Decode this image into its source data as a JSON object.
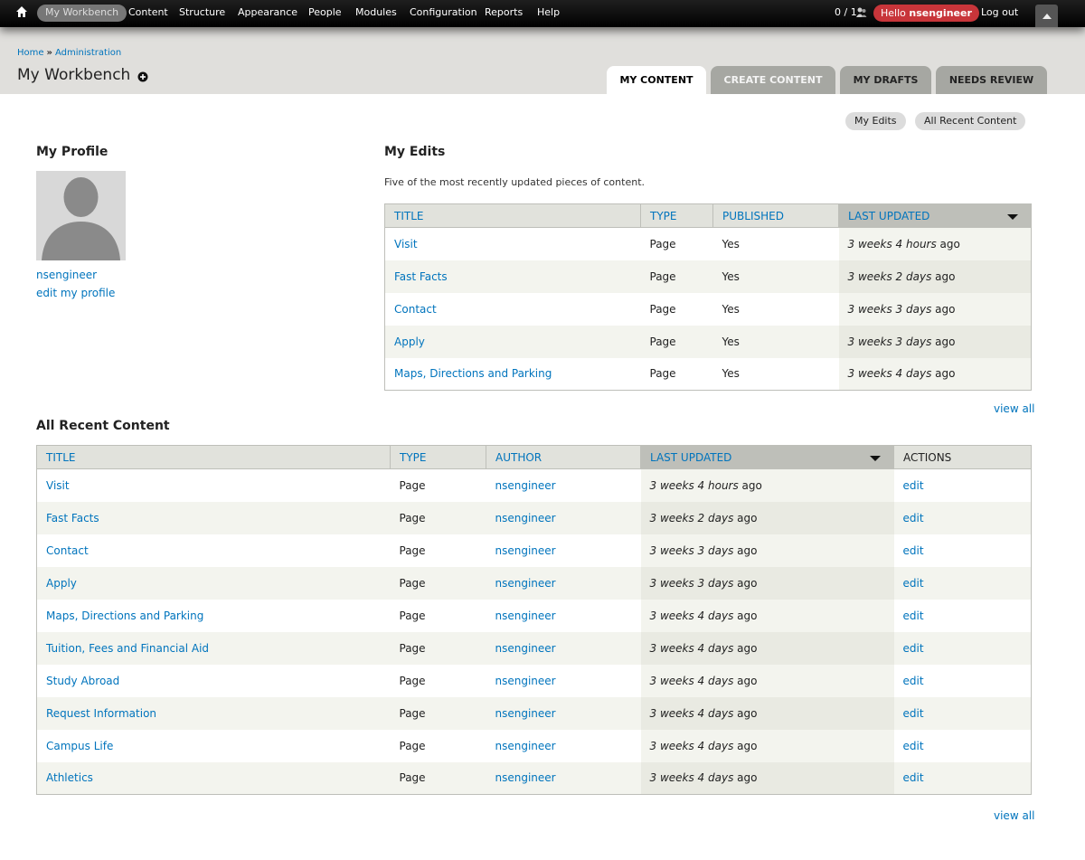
{
  "toolbar": {
    "home_icon": "home-icon",
    "items": [
      "My Workbench",
      "Content",
      "Structure",
      "Appearance",
      "People",
      "Modules",
      "Configuration",
      "Reports",
      "Help"
    ],
    "counter": "0 / 1",
    "people_icon": "people-icon",
    "hello_prefix": "Hello",
    "username": "nsengineer",
    "logout": "Log out",
    "drawer_icon": "triangle-up-icon"
  },
  "header": {
    "breadcrumb": [
      "Home",
      "Administration"
    ],
    "breadcrumb_sep": "»",
    "title": "My Workbench",
    "shortcut_icon": "plus-circle-icon",
    "tabs": [
      "My Content",
      "Create Content",
      "My Drafts",
      "Needs Review"
    ]
  },
  "subtabs": [
    "My Edits",
    "All Recent Content"
  ],
  "profile": {
    "heading": "My Profile",
    "avatar_icon": "user-silhouette-icon",
    "name": "nsengineer",
    "edit_link": "edit my profile"
  },
  "my_edits": {
    "heading": "My Edits",
    "description": "Five of the most recently updated pieces of content.",
    "columns": [
      "Title",
      "Type",
      "Published",
      "Last updated"
    ],
    "rows": [
      {
        "title": "Visit",
        "type": "Page",
        "published": "Yes",
        "updated_em": "3 weeks 4 hours",
        "updated_tail": " ago"
      },
      {
        "title": "Fast Facts",
        "type": "Page",
        "published": "Yes",
        "updated_em": "3 weeks 2 days",
        "updated_tail": " ago"
      },
      {
        "title": "Contact",
        "type": "Page",
        "published": "Yes",
        "updated_em": "3 weeks 3 days",
        "updated_tail": " ago"
      },
      {
        "title": "Apply",
        "type": "Page",
        "published": "Yes",
        "updated_em": "3 weeks 3 days",
        "updated_tail": " ago"
      },
      {
        "title": "Maps, Directions and Parking",
        "type": "Page",
        "published": "Yes",
        "updated_em": "3 weeks 4 days",
        "updated_tail": " ago"
      }
    ],
    "view_all": "view all"
  },
  "all_recent": {
    "heading": "All Recent Content",
    "columns": [
      "Title",
      "Type",
      "Author",
      "Last updated",
      "Actions"
    ],
    "rows": [
      {
        "title": "Visit",
        "type": "Page",
        "author": "nsengineer",
        "updated_em": "3 weeks 4 hours",
        "updated_tail": " ago",
        "action": "edit"
      },
      {
        "title": "Fast Facts",
        "type": "Page",
        "author": "nsengineer",
        "updated_em": "3 weeks 2 days",
        "updated_tail": " ago",
        "action": "edit"
      },
      {
        "title": "Contact",
        "type": "Page",
        "author": "nsengineer",
        "updated_em": "3 weeks 3 days",
        "updated_tail": " ago",
        "action": "edit"
      },
      {
        "title": "Apply",
        "type": "Page",
        "author": "nsengineer",
        "updated_em": "3 weeks 3 days",
        "updated_tail": " ago",
        "action": "edit"
      },
      {
        "title": "Maps, Directions and Parking",
        "type": "Page",
        "author": "nsengineer",
        "updated_em": "3 weeks 4 days",
        "updated_tail": " ago",
        "action": "edit"
      },
      {
        "title": "Tuition, Fees and Financial Aid",
        "type": "Page",
        "author": "nsengineer",
        "updated_em": "3 weeks 4 days",
        "updated_tail": " ago",
        "action": "edit"
      },
      {
        "title": "Study Abroad",
        "type": "Page",
        "author": "nsengineer",
        "updated_em": "3 weeks 4 days",
        "updated_tail": " ago",
        "action": "edit"
      },
      {
        "title": "Request Information",
        "type": "Page",
        "author": "nsengineer",
        "updated_em": "3 weeks 4 days",
        "updated_tail": " ago",
        "action": "edit"
      },
      {
        "title": "Campus Life",
        "type": "Page",
        "author": "nsengineer",
        "updated_em": "3 weeks 4 days",
        "updated_tail": " ago",
        "action": "edit"
      },
      {
        "title": "Athletics",
        "type": "Page",
        "author": "nsengineer",
        "updated_em": "3 weeks 4 days",
        "updated_tail": " ago",
        "action": "edit"
      }
    ],
    "view_all": "view all"
  },
  "colors": {
    "link": "#0074bd",
    "header_band": "#e0dfdc",
    "hello_badge": "#c8353a",
    "tab_inactive": "#a6a7a2"
  }
}
